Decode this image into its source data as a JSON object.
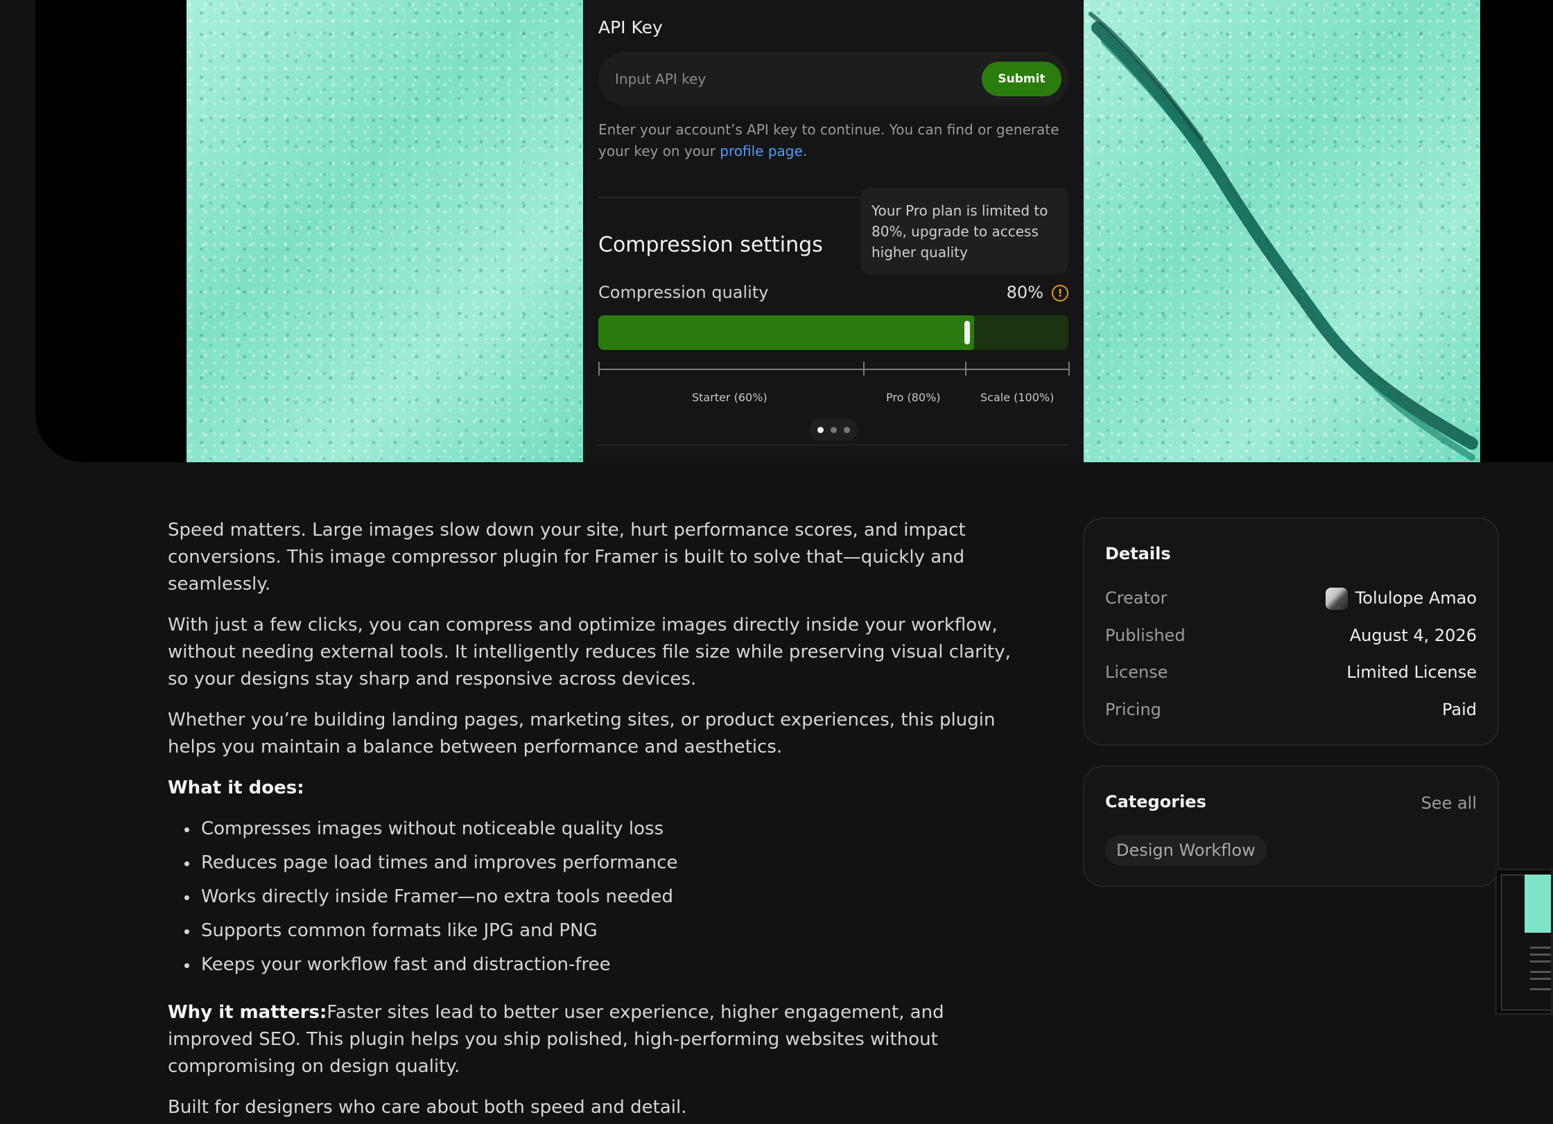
{
  "plugin_panel": {
    "api_title": "API Key",
    "api_placeholder": "Input API key",
    "submit_label": "Submit",
    "help_text": "Enter your account’s API key to continue. You can find or generate your key on your ",
    "help_link": "profile page",
    "help_suffix": ".",
    "tooltip": "Your Pro plan is limited to 80%, upgrade to access higher quality",
    "compression_title": "Compression settings",
    "quality_label": "Compression quality",
    "quality_value": "80%",
    "quality_fraction": 0.8,
    "tiers": [
      "Starter (60%)",
      "Pro (80%)",
      "Scale (100%)"
    ],
    "pager": {
      "count": 3,
      "active": 0
    },
    "accent_color": "#2a7d0c",
    "warning_color": "#e39b1c",
    "warning_icon": "info-circle-icon"
  },
  "description": {
    "p1": "Speed matters. Large images slow down your site, hurt performance scores, and impact conversions. This image compressor plugin for Framer is built to solve that—quickly and seamlessly.",
    "p2": "With just a few clicks, you can compress and optimize images directly inside your workflow, without needing external tools. It intelligently reduces file size while preserving visual clarity, so your designs stay sharp and responsive across devices.",
    "p3": "Whether you’re building landing pages, marketing sites, or product experiences, this plugin helps you maintain a balance between performance and aesthetics.",
    "what_heading": "What it does:",
    "features": [
      "Compresses images without noticeable quality loss",
      "Reduces page load times and improves performance",
      "Works directly inside Framer—no extra tools needed",
      "Supports common formats like JPG and PNG",
      "Keeps your workflow fast and distraction-free"
    ],
    "why_heading": "Why it matters:",
    "why_text": "Faster sites lead to better user experience, higher engagement, and improved SEO. This plugin helps you ship polished, high-performing websites without compromising on design quality.",
    "closing": "Built for designers who care about both speed and detail."
  },
  "details": {
    "title": "Details",
    "rows": [
      {
        "label": "Creator",
        "value": "Tolulope Amao"
      },
      {
        "label": "Published",
        "value": "August 4, 2026"
      },
      {
        "label": "License",
        "value": "Limited License"
      },
      {
        "label": "Pricing",
        "value": "Paid"
      }
    ]
  },
  "categories": {
    "title": "Categories",
    "see_all": "See all",
    "items": [
      "Design Workflow"
    ]
  }
}
